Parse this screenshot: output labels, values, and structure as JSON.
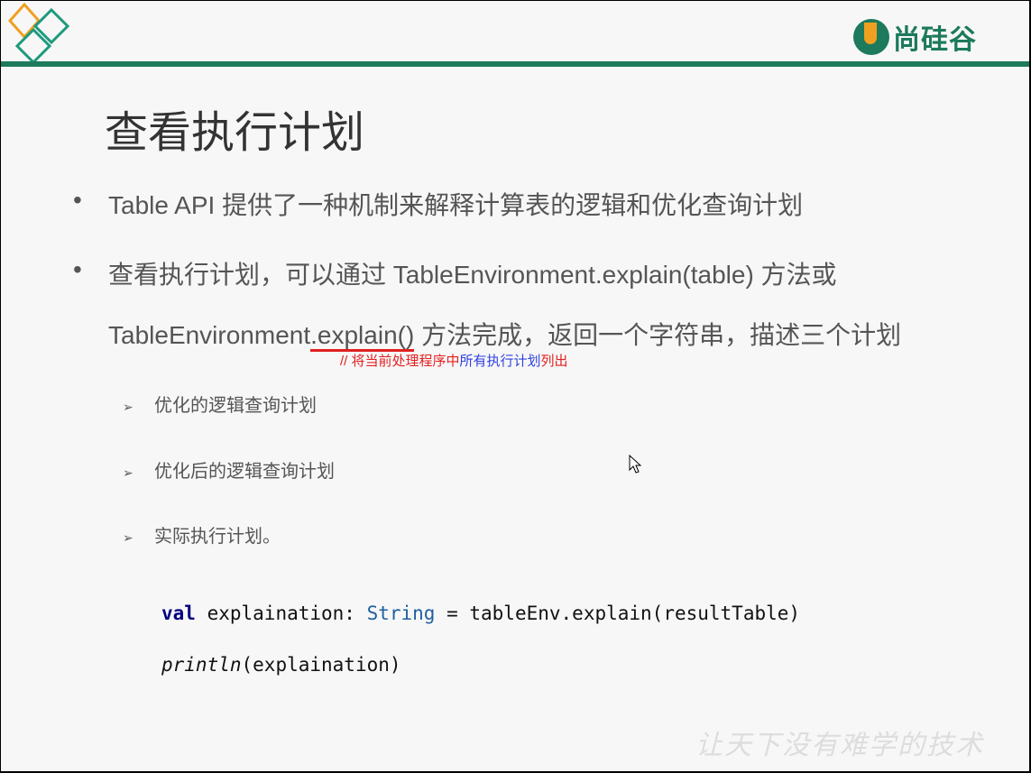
{
  "logo": {
    "text": "尚硅谷"
  },
  "title": "查看执行计划",
  "bullets": [
    {
      "text": "Table API 提供了一种机制来解释计算表的逻辑和优化查询计划"
    },
    {
      "line1": "查看执行计划，可以通过 TableEnvironment.explain(table) 方法或",
      "line2_pre": "TableEnvironment",
      "line2_under": ".explain()",
      "line2_post": " 方法完成，返回一个字符串，描述三个计划"
    }
  ],
  "comment": {
    "red1": "// 将当前处理程序中",
    "blue": "所有执行计划",
    "red2": "列出"
  },
  "sub_items": [
    "优化的逻辑查询计划",
    "优化后的逻辑查询计划",
    "实际执行计划。"
  ],
  "code": {
    "kw": "val",
    "l1a": " explaination: ",
    "type": "String",
    "l1b": " = tableEnv.explain(resultTable)",
    "fn": "println",
    "l2": "(explaination)"
  },
  "watermark": "让天下没有难学的技术",
  "colors": {
    "brand": "#1d7a5c",
    "accent": "#f0a020",
    "underline": "#e02020"
  }
}
